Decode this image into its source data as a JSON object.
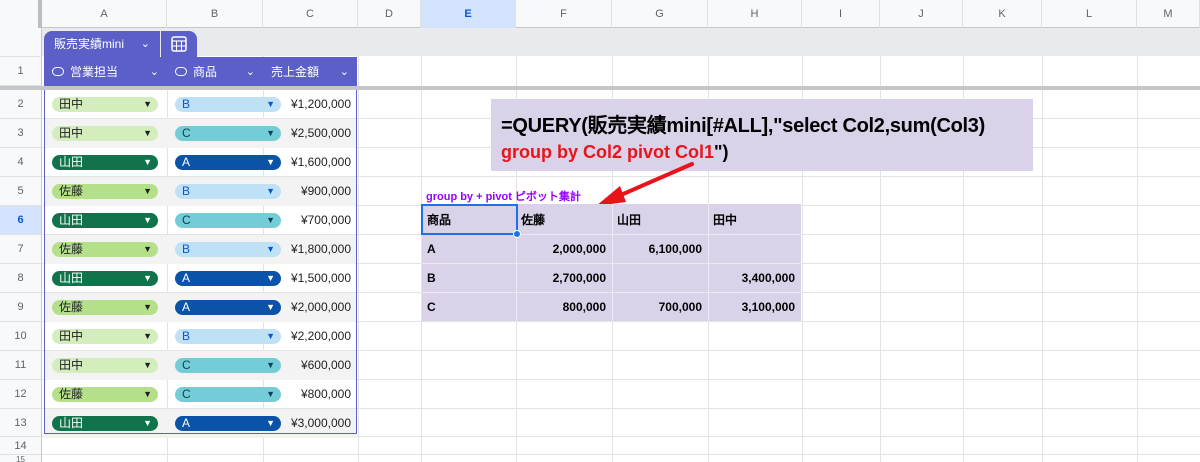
{
  "columns": [
    "A",
    "B",
    "C",
    "D",
    "E",
    "F",
    "G",
    "H",
    "I",
    "J",
    "K",
    "L",
    "M"
  ],
  "rows": [
    "1",
    "2",
    "3",
    "4",
    "5",
    "6",
    "7",
    "8",
    "9",
    "10",
    "11",
    "12",
    "13",
    "14",
    "15"
  ],
  "table": {
    "name": "販売実績mini",
    "headers": [
      "営業担当",
      "商品",
      "売上金額"
    ],
    "data": [
      {
        "rep": "田中",
        "product": "B",
        "amount": "¥1,200,000"
      },
      {
        "rep": "田中",
        "product": "C",
        "amount": "¥2,500,000"
      },
      {
        "rep": "山田",
        "product": "A",
        "amount": "¥1,600,000"
      },
      {
        "rep": "佐藤",
        "product": "B",
        "amount": "¥900,000"
      },
      {
        "rep": "山田",
        "product": "C",
        "amount": "¥700,000"
      },
      {
        "rep": "佐藤",
        "product": "B",
        "amount": "¥1,800,000"
      },
      {
        "rep": "山田",
        "product": "A",
        "amount": "¥1,500,000"
      },
      {
        "rep": "佐藤",
        "product": "A",
        "amount": "¥2,000,000"
      },
      {
        "rep": "田中",
        "product": "B",
        "amount": "¥2,200,000"
      },
      {
        "rep": "田中",
        "product": "C",
        "amount": "¥600,000"
      },
      {
        "rep": "佐藤",
        "product": "C",
        "amount": "¥800,000"
      },
      {
        "rep": "山田",
        "product": "A",
        "amount": "¥3,000,000"
      }
    ]
  },
  "formula": {
    "line1": "=QUERY(販売実績mini[#ALL],\"select Col2,sum(Col3)",
    "line2_red": "group by Col2 pivot Col1",
    "line2_tail": "\")"
  },
  "pivot_label": "group by + pivot ピボット集計",
  "pivot": {
    "headers": [
      "商品",
      "佐藤",
      "山田",
      "田中"
    ],
    "rows": [
      [
        "A",
        "2,000,000",
        "6,100,000",
        ""
      ],
      [
        "B",
        "2,700,000",
        "",
        "3,400,000"
      ],
      [
        "C",
        "800,000",
        "700,000",
        "3,100,000"
      ]
    ]
  },
  "colors": {
    "table_header": "#5b5fc7",
    "chip_tanaka": "#d4edbc",
    "chip_yamada": "#11734b",
    "chip_sato": "#b5e08a",
    "chip_A": "#0a53a8",
    "chip_B": "#bfe1f6",
    "chip_C": "#74cdd6",
    "formula_bg": "#d9d2e9",
    "formula_red": "#e8141a",
    "pivot_label": "#9900ff",
    "selection": "#1a73e8"
  },
  "selected_cell": "E6"
}
